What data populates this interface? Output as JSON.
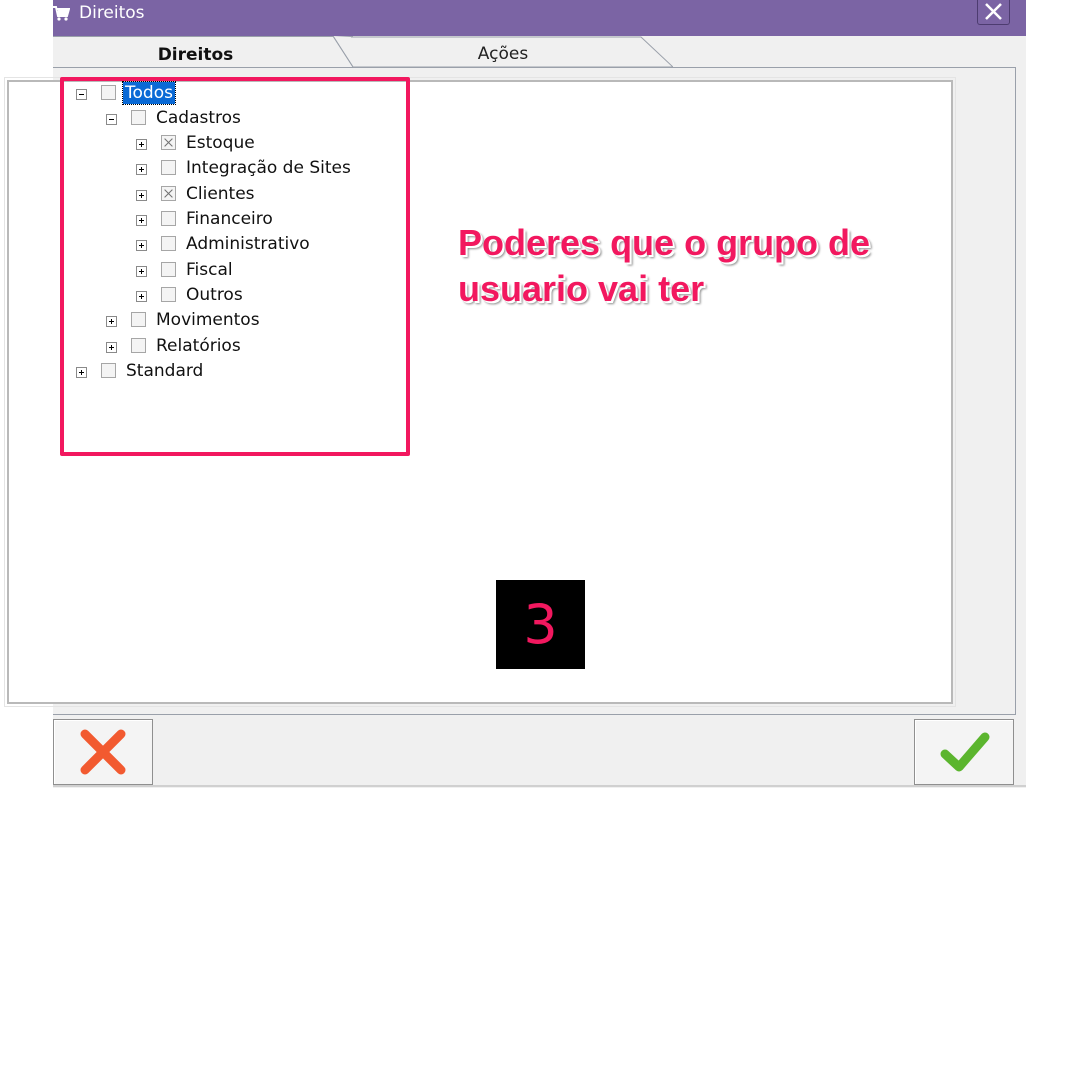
{
  "window": {
    "title": "Direitos",
    "title_icon": "cart-icon",
    "close_icon": "close-icon"
  },
  "tabs": [
    {
      "label": "Direitos",
      "active": true
    },
    {
      "label": "Ações",
      "active": false
    }
  ],
  "tree": {
    "todos": {
      "label": "Todos",
      "selected": true
    },
    "cadastros": {
      "label": "Cadastros"
    },
    "estoque": {
      "label": "Estoque",
      "checked": "indeterminate"
    },
    "integracao": {
      "label": "Integração de Sites"
    },
    "clientes": {
      "label": "Clientes",
      "checked": "indeterminate"
    },
    "financeiro": {
      "label": "Financeiro"
    },
    "administrativo": {
      "label": "Administrativo"
    },
    "fiscal": {
      "label": "Fiscal"
    },
    "outros": {
      "label": "Outros"
    },
    "movimentos": {
      "label": "Movimentos"
    },
    "relatorios": {
      "label": "Relatórios"
    },
    "standard": {
      "label": "Standard"
    }
  },
  "annotation": {
    "line1": "Poderes que o grupo de",
    "line2": "usuario vai ter",
    "color": "#f2185f"
  },
  "step_badge": "3",
  "buttons": {
    "cancel_icon": "red-x-icon",
    "ok_icon": "green-check-icon"
  },
  "colors": {
    "titlebar": "#7b64a4",
    "highlight": "#f2185f",
    "selection": "#0a6ad6"
  }
}
